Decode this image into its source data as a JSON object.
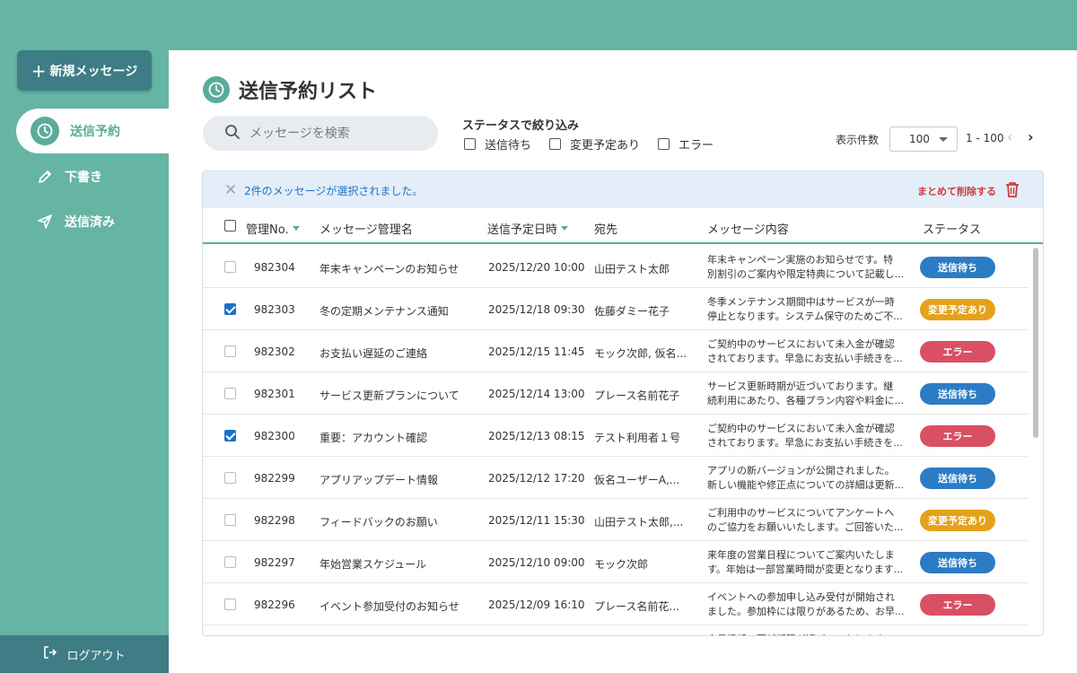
{
  "sidebar": {
    "new_message_label": "新規メッセージ",
    "items": [
      {
        "label": "送信予約",
        "icon": "clock-icon",
        "active": true
      },
      {
        "label": "下書き",
        "icon": "pencil-icon",
        "active": false
      },
      {
        "label": "送信済み",
        "icon": "paper-plane-icon",
        "active": false
      }
    ],
    "logout_label": "ログアウト"
  },
  "main": {
    "title": "送信予約リスト",
    "search_placeholder": "メッセージを検索",
    "filter_title": "ステータスで絞り込み",
    "filters": [
      {
        "label": "送信待ち",
        "checked": false
      },
      {
        "label": "変更予定あり",
        "checked": false
      },
      {
        "label": "エラー",
        "checked": false
      }
    ],
    "pager": {
      "label": "表示件数",
      "page_size": "100",
      "range": "1 - 100"
    }
  },
  "selection_bar": {
    "message": "2件のメッセージが選択されました。",
    "delete_label": "まとめて削除する"
  },
  "table": {
    "headers": {
      "no": "管理No.",
      "name": "メッセージ管理名",
      "date": "送信予定日時",
      "to": "宛先",
      "content": "メッセージ内容",
      "status": "ステータス"
    },
    "rows": [
      {
        "checked": false,
        "no": "982304",
        "name": "年末キャンペーンのお知らせ",
        "date": "2025/12/20 10:00",
        "to": "山田テスト太郎",
        "content": "年末キャンペーン実施のお知らせです。特\n別割引のご案内や限定特典について記載し...",
        "status": "送信待ち",
        "status_color": "#2b7cc4"
      },
      {
        "checked": true,
        "no": "982303",
        "name": "冬の定期メンテナンス通知",
        "date": "2025/12/18 09:30",
        "to": "佐藤ダミー花子",
        "content": "冬季メンテナンス期間中はサービスが一時\n停止となります。システム保守のためご不...",
        "status": "変更予定あり",
        "status_color": "#e3a21a"
      },
      {
        "checked": false,
        "no": "982302",
        "name": "お支払い遅延のご連絡",
        "date": "2025/12/15 11:45",
        "to": "モック次郎, 仮名...",
        "content": "ご契約中のサービスにおいて未入金が確認\nされております。早急にお支払い手続きを...",
        "status": "エラー",
        "status_color": "#d95064"
      },
      {
        "checked": false,
        "no": "982301",
        "name": "サービス更新プランについて",
        "date": "2025/12/14 13:00",
        "to": "プレース名前花子",
        "content": "サービス更新時期が近づいております。継\n続利用にあたり、各種プラン内容や料金に...",
        "status": "送信待ち",
        "status_color": "#2b7cc4"
      },
      {
        "checked": true,
        "no": "982300",
        "name": "重要：アカウント確認",
        "date": "2025/12/13 08:15",
        "to": "テスト利用者１号",
        "content": "ご契約中のサービスにおいて未入金が確認\nされております。早急にお支払い手続きを...",
        "status": "エラー",
        "status_color": "#d95064"
      },
      {
        "checked": false,
        "no": "982299",
        "name": "アプリアップデート情報",
        "date": "2025/12/12 17:20",
        "to": "仮名ユーザーA,...",
        "content": "アプリの新バージョンが公開されました。\n新しい機能や修正点についての詳細は更新...",
        "status": "送信待ち",
        "status_color": "#2b7cc4"
      },
      {
        "checked": false,
        "no": "982298",
        "name": "フィードバックのお願い",
        "date": "2025/12/11 15:30",
        "to": "山田テスト太郎,...",
        "content": "ご利用中のサービスについてアンケートへ\nのご協力をお願いいたします。ご回答いた...",
        "status": "変更予定あり",
        "status_color": "#e3a21a"
      },
      {
        "checked": false,
        "no": "982297",
        "name": "年始営業スケジュール",
        "date": "2025/12/10 09:00",
        "to": "モック次郎",
        "content": "来年度の営業日程についてご案内いたしま\nす。年始は一部営業時間が変更となります...",
        "status": "送信待ち",
        "status_color": "#2b7cc4"
      },
      {
        "checked": false,
        "no": "982296",
        "name": "イベント参加受付のお知らせ",
        "date": "2025/12/09 16:10",
        "to": "プレース名前花...",
        "content": "イベントへの参加申し込み受付が開始され\nました。参加枠には限りがあるため、お早...",
        "status": "エラー",
        "status_color": "#d95064"
      },
      {
        "checked": false,
        "no": "",
        "name": "",
        "date": "",
        "to": "",
        "content": "会員情報の更新期限が近づいております...",
        "status": "",
        "status_color": "#2b7cc4"
      }
    ]
  },
  "colors": {
    "accent": "#5aab99",
    "sidebar": "#66b5a4",
    "sidebar_dark": "#3e7c86",
    "error": "#d95064",
    "pending": "#2b7cc4",
    "change": "#e3a21a"
  }
}
